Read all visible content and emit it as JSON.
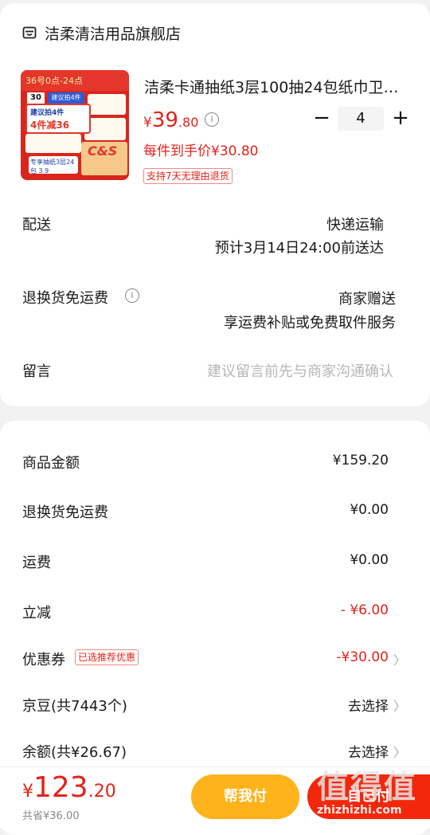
{
  "store": {
    "name": "洁柔清洁用品旗舰店",
    "icon": "store-icon"
  },
  "product": {
    "title": "洁柔卡通抽纸3层100抽24包纸巾卫…",
    "price_currency": "¥",
    "price_int": "39",
    "price_dec": ".80",
    "quantity": "4",
    "minus": "−",
    "plus": "+",
    "unit_price": "每件到手价¥30.80",
    "return_badge": "支持7天无理由退货",
    "image_text": {
      "banner": "36号0点-24点",
      "thirty": "30",
      "blue": "建议拍4件",
      "promo_l1": "建议拍4件",
      "promo_l2": "4件减36",
      "brand": "C&S",
      "bottom": "专享抽纸3层24包 3.9"
    }
  },
  "delivery": {
    "label": "配送",
    "method": "快递运输",
    "eta": "预计3月14日24:00前送达"
  },
  "return_shipping": {
    "label": "退换货免运费",
    "value1": "商家赠送",
    "value2": "享运费补贴或免费取件服务"
  },
  "message": {
    "label": "留言",
    "placeholder": "建议留言前先与商家沟通确认"
  },
  "summary": {
    "goods_amount": {
      "label": "商品金额",
      "value": "¥159.20"
    },
    "return_fee": {
      "label": "退换货免运费",
      "value": "¥0.00"
    },
    "shipping": {
      "label": "运费",
      "value": "¥0.00"
    },
    "instant_discount": {
      "label": "立减",
      "value": "- ¥6.00"
    },
    "coupon": {
      "label": "优惠券",
      "badge": "已选推荐优惠",
      "value": "-¥30.00"
    },
    "jingdou": {
      "label": "京豆(共7443个)",
      "value": "去选择"
    },
    "balance": {
      "label": "余额(共¥26.67)",
      "value": "去选择"
    }
  },
  "bottom": {
    "currency": "¥",
    "total_int": "123",
    "total_dec": ".20",
    "saved": "共省¥36.00",
    "help_pay": "帮我付",
    "pay": "自己付",
    "watermark": "值得值",
    "watermark_url": "zhizhizhi.com"
  },
  "colors": {
    "accent_red": "#e2231a",
    "help_pay": "#ffb31b",
    "pay": "#f2270c"
  }
}
